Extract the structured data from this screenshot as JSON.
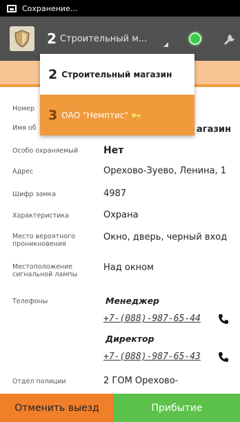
{
  "status_bar": {
    "text": "Сохранение..."
  },
  "action_bar": {
    "spinner_number": "2",
    "spinner_label": "Строительный м..."
  },
  "dropdown": {
    "items": [
      {
        "number": "2",
        "label": "Строительный магазин"
      },
      {
        "number": "3",
        "label": "ОАО \"Немптис\""
      }
    ]
  },
  "fields": {
    "number_label": "Номер",
    "name_label": "Имя об",
    "name_value_partial": "агазин",
    "guarded_label": "Особо охраняемый",
    "guarded_value": "Нет",
    "address_label": "Адрес",
    "address_value": "Орехово-Зуево, Ленина, 1",
    "lock_code_label": "Шифр замка",
    "lock_code_value": "4987",
    "characteristic_label": "Характеристика",
    "characteristic_value": "Охрана",
    "entry_label": "Место вероятного проникновения",
    "entry_value": "Окно, дверь, черный вход",
    "lamp_label": "Местоположение сигнальной лампы",
    "lamp_value": "Над окном",
    "phones_label": "Телефоны",
    "police_label": "Отдел полиции",
    "police_value": "2 ГОМ  Орехово-"
  },
  "phones": [
    {
      "role": "Менеджер",
      "number": "+7-(088)-987-65-44"
    },
    {
      "role": "Директор",
      "number": "+7-(088)-987-65-43"
    }
  ],
  "buttons": {
    "cancel": "Отменить выезд",
    "arrive": "Прибытие"
  },
  "colors": {
    "accent_orange": "#f09a3c",
    "cancel_button": "#f07f2a",
    "arrive_button": "#5cc24b",
    "action_bar": "#505050"
  }
}
